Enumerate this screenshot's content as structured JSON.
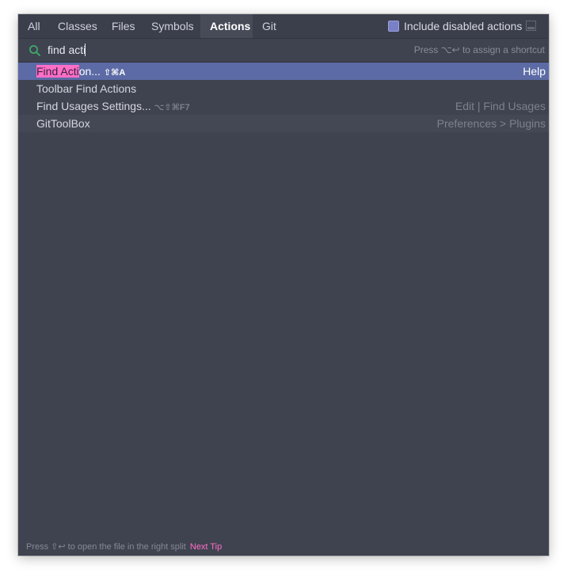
{
  "tabs": [
    {
      "label": "All",
      "active": false
    },
    {
      "label": "Classes",
      "active": false
    },
    {
      "label": "Files",
      "active": false
    },
    {
      "label": "Symbols",
      "active": false
    },
    {
      "label": "Actions",
      "active": true
    },
    {
      "label": "Git",
      "active": false
    }
  ],
  "options": {
    "include_disabled_label": "Include disabled actions",
    "include_disabled_checked": false
  },
  "search": {
    "value": "find acti",
    "hint": "Press ⌥↩ to assign a shortcut",
    "icon": "search-icon"
  },
  "results": [
    {
      "highlight": "Find Acti",
      "name_rest": "on...",
      "shortcut": "⇧⌘A",
      "location": "Help",
      "selected": true
    },
    {
      "highlight": "",
      "name_rest": "Toolbar Find Actions",
      "shortcut": "",
      "location": "",
      "selected": false
    },
    {
      "highlight": "",
      "name_rest": "Find Usages Settings...",
      "shortcut": "⌥⇧⌘F7",
      "location": "Edit | Find Usages",
      "selected": false
    },
    {
      "highlight": "",
      "name_rest": "GitToolBox",
      "shortcut": "",
      "location": "Preferences > Plugins",
      "selected": false
    }
  ],
  "footer": {
    "tip_text": "Press ⇧↩ to open the file in the right split",
    "next_tip_label": "Next Tip"
  },
  "colors": {
    "background": "#3f4350",
    "selection": "#5c6aa5",
    "match_highlight": "#ff6ec7",
    "accent_link": "#ff6ec7",
    "search_icon": "#3fae6a"
  }
}
